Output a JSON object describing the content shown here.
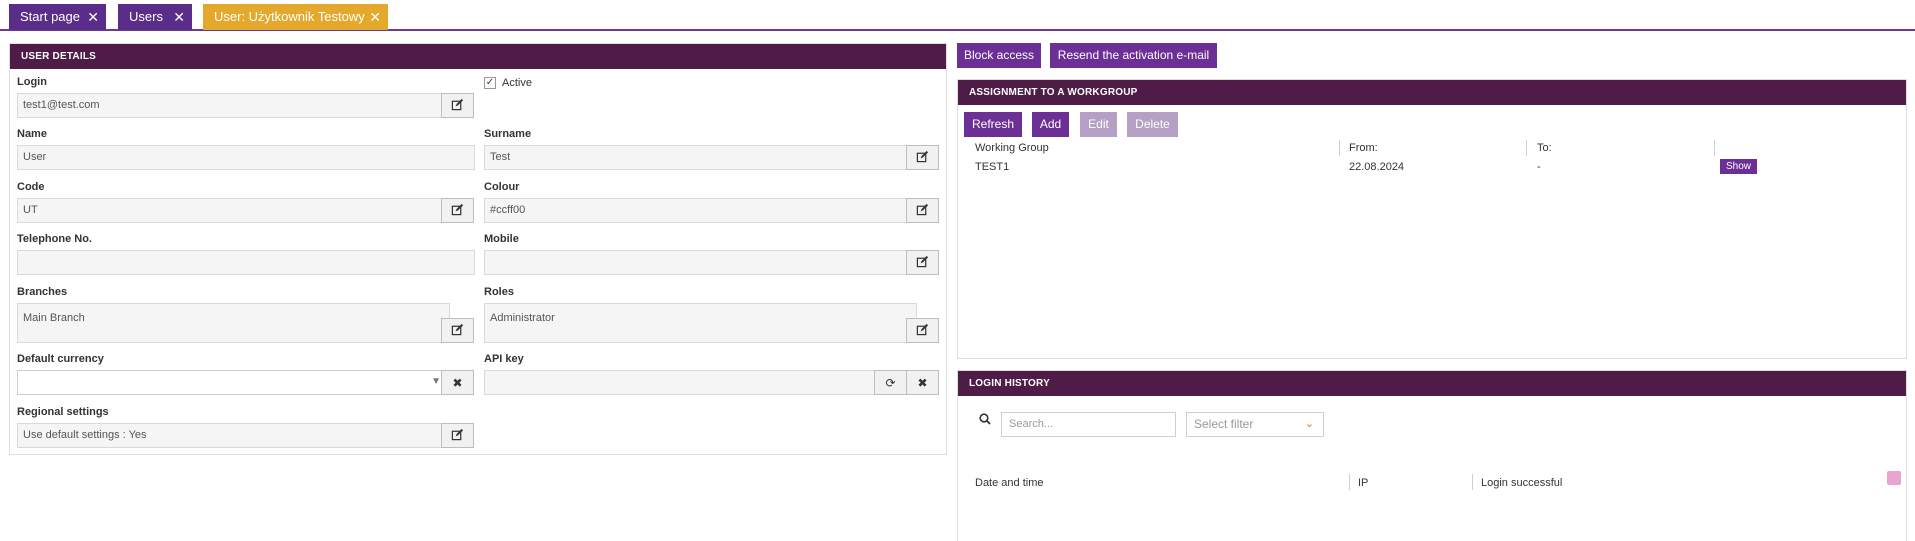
{
  "tabs": [
    {
      "label": "Start page"
    },
    {
      "label": "Users"
    },
    {
      "label": "User: Użytkownik Testowy"
    }
  ],
  "tab_close_glyph": "✕",
  "user_details": {
    "header": "USER DETAILS",
    "login_label": "Login",
    "login_value": "test1@test.com",
    "active_label": "Active",
    "active_checked": true,
    "name_label": "Name",
    "name_value": "User",
    "surname_label": "Surname",
    "surname_value": "Test",
    "code_label": "Code",
    "code_value": "UT",
    "colour_label": "Colour",
    "colour_value": "#ccff00",
    "telephone_label": "Telephone No.",
    "telephone_value": "",
    "mobile_label": "Mobile",
    "mobile_value": "",
    "branches_label": "Branches",
    "branches_value": "Main Branch",
    "roles_label": "Roles",
    "roles_value": "Administrator",
    "currency_label": "Default currency",
    "currency_value": "",
    "apikey_label": "API key",
    "apikey_value": "",
    "regional_label": "Regional settings",
    "regional_value": "Use default settings : Yes"
  },
  "actions": {
    "block_access": "Block access",
    "resend_activation": "Resend the activation e-mail"
  },
  "workgroup": {
    "header": "ASSIGNMENT TO A WORKGROUP",
    "refresh": "Refresh",
    "add": "Add",
    "edit": "Edit",
    "delete": "Delete",
    "columns": [
      "Working Group",
      "From:",
      "To:"
    ],
    "rows": [
      {
        "group": "TEST1",
        "from": "22.08.2024",
        "to": "-",
        "action": "Show"
      }
    ]
  },
  "login_history": {
    "header": "LOGIN HISTORY",
    "search_placeholder": "Search...",
    "filter_placeholder": "Select filter",
    "columns": [
      "Date and time",
      "IP",
      "Login successful"
    ]
  },
  "colors": {
    "tab_active": "#e4a92c",
    "tab_default": "#5b2d8a",
    "panel_header": "#4e1c47",
    "primary_button": "#6b2f95",
    "disabled_button": "#b59fc5"
  }
}
